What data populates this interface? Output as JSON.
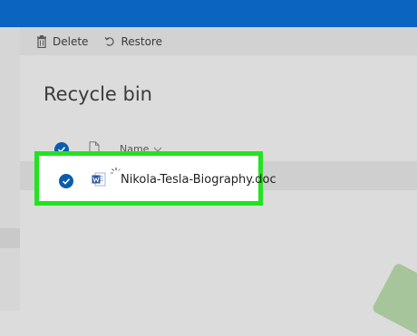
{
  "toolbar": {
    "delete_label": "Delete",
    "restore_label": "Restore"
  },
  "page": {
    "title": "Recycle bin"
  },
  "list": {
    "name_header": "Name",
    "items": [
      {
        "name": "Nikola-Tesla-Biography.doc",
        "icon": "word-doc-icon",
        "selected": true
      }
    ]
  },
  "colors": {
    "accent": "#0a64c0",
    "highlight": "#22e31f"
  }
}
